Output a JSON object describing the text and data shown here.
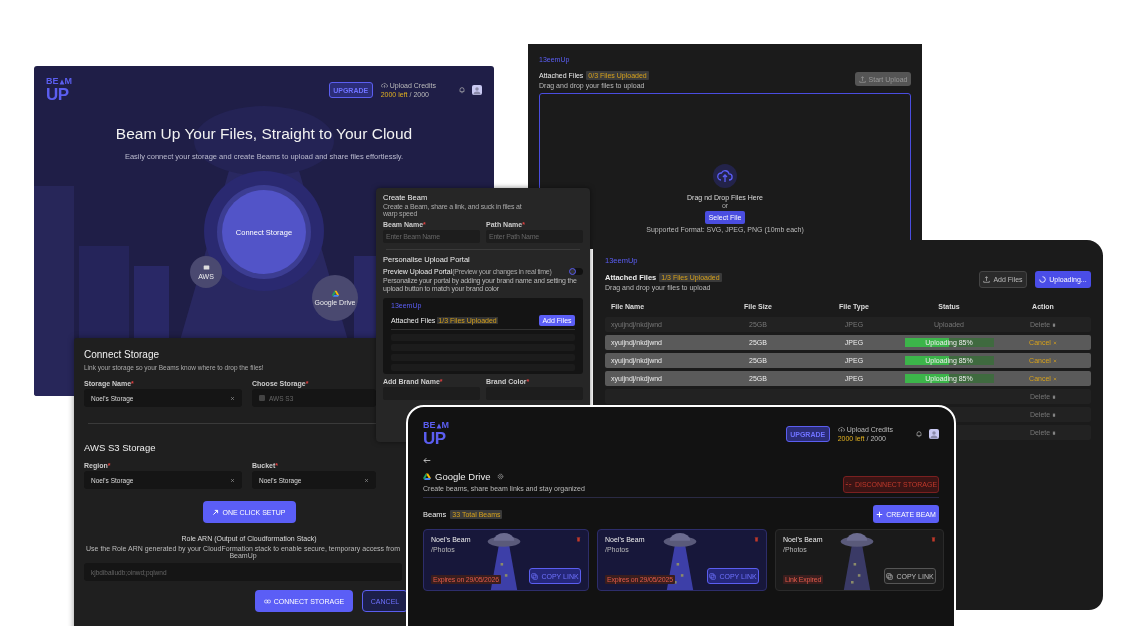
{
  "hero_window": {
    "logo": {
      "top_left": "BE",
      "top_right": "M",
      "bottom": "UP"
    },
    "upgrade_button": "UPGRADE",
    "credits": {
      "label": "Upload Credits",
      "remaining": "2000 left",
      "total": "/ 2000"
    },
    "title": "Beam Up Your Files, Straight to Your Cloud",
    "subtitle": "Easily connect your storage and create Beams to upload and share files effortlessly.",
    "connect_button": "Connect Storage",
    "storage_options": [
      {
        "label": "AWS",
        "kind": "aws"
      },
      {
        "label": "Google Drive",
        "kind": "gdrive"
      }
    ]
  },
  "connect_storage_dialog": {
    "title": "Connect Storage",
    "subtitle": "Link your storage so your Beams know where to drop the files!",
    "fields": [
      {
        "label": "Storage Name",
        "required_mark": "*",
        "value": "Noel's Storage",
        "kind": "text"
      },
      {
        "label": "Choose Storage",
        "required_mark": "*",
        "placeholder": "AWS S3",
        "kind": "select"
      }
    ],
    "section_title": "AWS S3 Storage",
    "s3_fields": [
      {
        "label": "Region",
        "required_mark": "*",
        "value": "Noel's Storage",
        "kind": "text"
      },
      {
        "label": "Bucket",
        "required_mark": "*",
        "value": "Noel's Storage",
        "kind": "text"
      }
    ],
    "setup_button": "ONE CLICK SETUP",
    "role_title": "Role ARN (Output of Cloudformation Stack)",
    "role_hint": "Use the Role ARN generated by your CloudFormation stack to enable secure, temporary access from BeamUp",
    "role_value": "kjbdibaliudb;oinwd;pqlwnd",
    "connect_button": "CONNECT STORAGE",
    "cancel_button": "CANCEL"
  },
  "create_beam_panel": {
    "title": "Create Beam",
    "subtitle": "Create a Beam, share a link, and suck in files at warp speed",
    "fields": [
      {
        "label": "Beam Name",
        "required_mark": "*",
        "placeholder": "Enter Beam Name"
      },
      {
        "label": "Path Name",
        "required_mark": "*",
        "placeholder": "Enter Path Name"
      }
    ],
    "section_title": "Personalise Upload Portal",
    "preview_label": "Preview Upload Portal",
    "preview_hint": "(Preview your changes in real time)",
    "preview_on": false,
    "description": "Personalize your portal by adding your brand name and setting the upload button to match your brand color",
    "preview": {
      "brand": "13eemUp",
      "title": "Attached Files",
      "badge": "1/3 Files Uploaded",
      "button": "Add Files"
    },
    "brand_fields": [
      {
        "label": "Add Brand Name",
        "required_mark": "*"
      },
      {
        "label": "Brand Color",
        "required_mark": "*"
      }
    ]
  },
  "upload_portal": {
    "brand": "13eemUp",
    "title": "Attached Files",
    "badge": "0/3 Files Uploaded",
    "hint": "Drag and drop your files to upload",
    "start_button": {
      "label": "Start Upload",
      "disabled": true
    },
    "drop_title": "Drag nd Drop Files Here",
    "or": "or",
    "select_button": "Select File",
    "formats": "Supported Format: SVG, JPEG, PNG (10mb each)"
  },
  "upload_table_window": {
    "brand": "13eemUp",
    "title": "Attached Files",
    "badge": "1/3 Files Uploaded",
    "hint": "Drag and drop your files to upload",
    "add_button": "Add Files",
    "uploading_button": "Uploading...",
    "columns": [
      "File Name",
      "File Size",
      "File Type",
      "Status",
      "Action"
    ],
    "rows": [
      {
        "kind": "uploaded",
        "name": "xyuijndj/nkdjwnd",
        "size": "25GB",
        "type": "JPEG",
        "status": "Uploaded",
        "action": "Delete"
      },
      {
        "kind": "uploading",
        "name": "xyuijndj/nkdjwnd",
        "size": "25GB",
        "type": "JPEG",
        "status": "Uploading 85%",
        "level": 0.5,
        "action": "Cancel"
      },
      {
        "kind": "uploading",
        "name": "xyuijndj/nkdjwnd",
        "size": "25GB",
        "type": "JPEG",
        "status": "Uploading 85%",
        "level": 0.5,
        "action": "Cancel"
      },
      {
        "kind": "uploading",
        "name": "xyuijndj/nkdjwnd",
        "size": "25GB",
        "type": "JPEG",
        "status": "Uploading 85%",
        "level": 0.5,
        "action": "Cancel"
      },
      {
        "kind": "uploaded",
        "action": "Delete"
      },
      {
        "kind": "uploaded",
        "action": "Delete"
      },
      {
        "kind": "uploaded",
        "action": "Delete"
      }
    ]
  },
  "drive_window": {
    "logo": {
      "top_left": "BE",
      "top_right": "M",
      "bottom": "UP"
    },
    "upgrade_button": "UPGRADE",
    "credits": {
      "label": "Upload Credits",
      "remaining": "2000 left",
      "total": "/ 2000"
    },
    "title": "Google Drive",
    "subtitle": "Create beams, share beam links and stay organized",
    "disconnect_button": "DISCONNECT STORAGE",
    "beams_label": "Beams",
    "beams_badge": "33 Total Beams",
    "create_button": "CREATE BEAM",
    "cards": [
      {
        "name": "Noel's Beam",
        "path": "/Photos",
        "tag": "Expires on 29/05/2026",
        "expired": false,
        "copy_button": "COPY LINK"
      },
      {
        "name": "Noel's Beam",
        "path": "/Photos",
        "tag": "Expires on 29/05/2025",
        "expired": false,
        "copy_button": "COPY LINK"
      },
      {
        "name": "Noel's Beam",
        "path": "/Photos",
        "tag": "Link Expired",
        "expired": true,
        "copy_button": "COPY LINK"
      }
    ]
  }
}
